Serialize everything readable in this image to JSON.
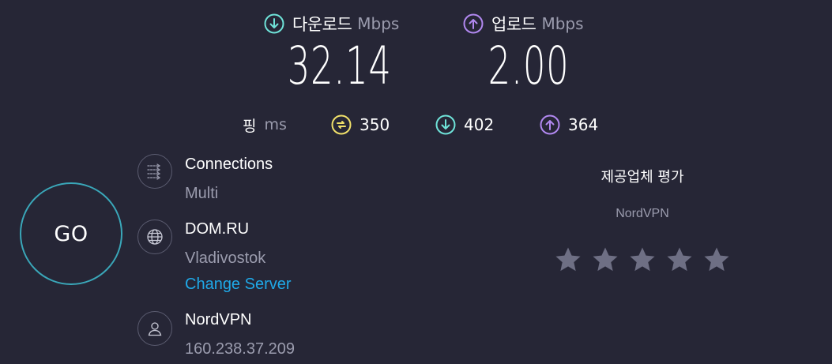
{
  "download": {
    "label": "다운로드",
    "unit": "Mbps",
    "value": "32.14",
    "icon": "arrow-down-circle-icon",
    "color": "#6fe3d9"
  },
  "upload": {
    "label": "업로드",
    "unit": "Mbps",
    "value": "2.00",
    "icon": "arrow-up-circle-icon",
    "color": "#b188f0"
  },
  "ping": {
    "label": "핑",
    "unit": "ms",
    "idle": {
      "value": "350",
      "icon": "latency-icon",
      "color": "#f0e06a"
    },
    "download": {
      "value": "402",
      "icon": "arrow-down-circle-icon",
      "color": "#6fe3d9"
    },
    "upload": {
      "value": "364",
      "icon": "arrow-up-circle-icon",
      "color": "#b188f0"
    }
  },
  "go_button": {
    "label": "GO",
    "ring_color": "#3aa7b9"
  },
  "connections": {
    "title": "Connections",
    "value": "Multi",
    "icon": "connections-icon"
  },
  "server": {
    "title": "DOM.RU",
    "location": "Vladivostok",
    "change_label": "Change Server",
    "icon": "globe-icon",
    "link_color": "#1fa9e8"
  },
  "provider": {
    "title": "NordVPN",
    "ip": "160.238.37.209",
    "icon": "user-icon"
  },
  "rating": {
    "title": "제공업체 평가",
    "provider": "NordVPN",
    "stars_total": 5,
    "stars_selected": 0,
    "star_icon": "star-icon"
  }
}
